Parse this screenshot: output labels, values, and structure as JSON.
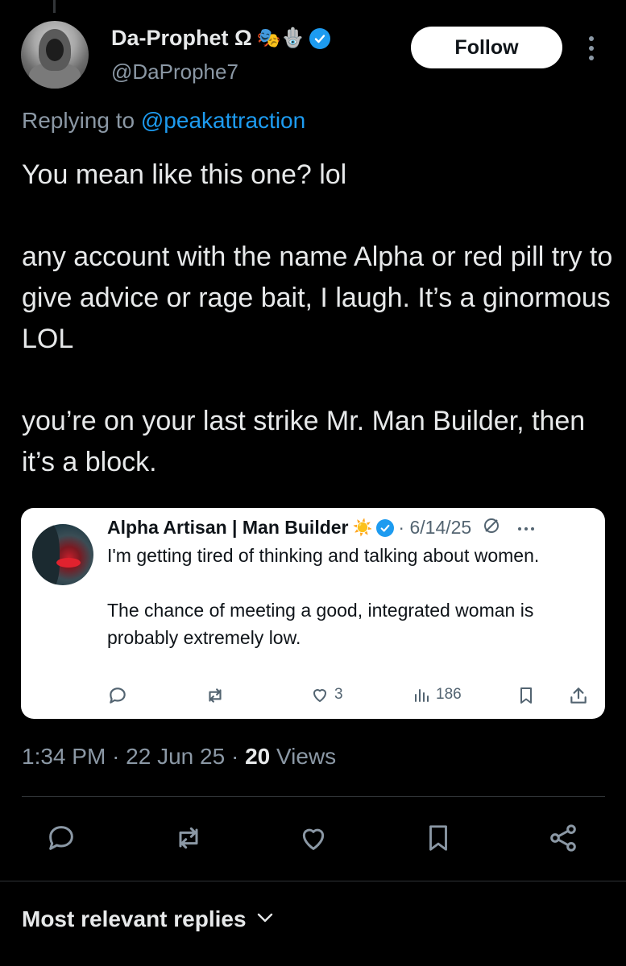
{
  "post": {
    "display_name": "Da-Prophet Ω",
    "name_emojis": "🎭🪬",
    "handle": "@DaProphe7",
    "follow_label": "Follow",
    "replying_prefix": "Replying to",
    "replying_to": "@peakattraction",
    "text": "You mean like this one? lol\n\nany account with the name Alpha or red pill try to give advice or rage bait, I laugh. It’s a ginormous LOL\n\nyou’re on your last strike Mr. Man Builder, then it’s a block.",
    "time": "1:34 PM",
    "date": "22 Jun 25",
    "views_count": "20",
    "views_label": "Views"
  },
  "quote": {
    "display_name": "Alpha Artisan | Man Builder",
    "name_emoji": "☀️",
    "date": "· 6/14/25",
    "text": "I'm getting tired of thinking and talking about women.\n\nThe chance of meeting a good, integrated woman is probably extremely low.",
    "likes": "3",
    "views": "186"
  },
  "replies": {
    "sort_label": "Most relevant replies"
  },
  "colors": {
    "accent": "#1d9bf0",
    "background": "#000000",
    "text": "#e7e9ea",
    "secondary": "#8b98a5"
  },
  "icons": [
    "verified-badge-icon",
    "more-icon",
    "reply-icon",
    "retweet-icon",
    "like-icon",
    "views-icon",
    "bookmark-icon",
    "share-icon",
    "chevron-down-icon"
  ]
}
